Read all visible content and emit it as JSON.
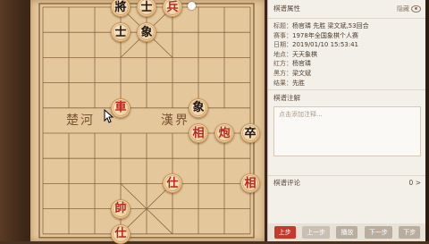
{
  "board": {
    "river_left": "楚河",
    "river_right": "漢界",
    "pieces": [
      {
        "char": "將",
        "side": "black",
        "col": 3,
        "row": 0
      },
      {
        "char": "士",
        "side": "black",
        "col": 4,
        "row": 0
      },
      {
        "char": "兵",
        "side": "red",
        "col": 5,
        "row": 0
      },
      {
        "char": "士",
        "side": "black",
        "col": 3,
        "row": 1
      },
      {
        "char": "象",
        "side": "black",
        "col": 4,
        "row": 1
      },
      {
        "char": "車",
        "side": "red",
        "col": 3,
        "row": 4
      },
      {
        "char": "象",
        "side": "black",
        "col": 6,
        "row": 4
      },
      {
        "char": "相",
        "side": "red",
        "col": 6,
        "row": 5
      },
      {
        "char": "炮",
        "side": "red",
        "col": 7,
        "row": 5
      },
      {
        "char": "卒",
        "side": "black",
        "col": 8,
        "row": 5
      },
      {
        "char": "仕",
        "side": "red",
        "col": 5,
        "row": 7
      },
      {
        "char": "相",
        "side": "red",
        "col": 8,
        "row": 7
      },
      {
        "char": "帥",
        "side": "red",
        "col": 3,
        "row": 8
      },
      {
        "char": "仕",
        "side": "red",
        "col": 3,
        "row": 9
      }
    ]
  },
  "panel": {
    "properties_title": "棋谱属性",
    "hide_label": "隐藏",
    "props": [
      {
        "key": "标题：",
        "value": "杨官璘 先胜 梁文斌,53回合"
      },
      {
        "key": "赛事：",
        "value": "1978年全国象棋个人赛"
      },
      {
        "key": "日期：",
        "value": "2019/01/10 15:53:41"
      },
      {
        "key": "地点：",
        "value": "天天象棋"
      },
      {
        "key": "红方：",
        "value": "杨官璘"
      },
      {
        "key": "黑方：",
        "value": "梁文斌"
      },
      {
        "key": "结果：",
        "value": "先胜"
      }
    ],
    "notes_title": "棋谱注解",
    "notes_placeholder": "点击添加注释...",
    "comment_title": "棋谱评论",
    "comment_arrow": "0 >",
    "controls": [
      "上步",
      "上一步",
      "播放",
      "下一步",
      "下步"
    ]
  },
  "colors": {
    "red_piece": "#b8261c",
    "black_piece": "#1e1510",
    "board": "#e4c79b",
    "active_control": "#c8392b"
  },
  "icons": {
    "hide": "eye-icon",
    "cursor": "pointer-cursor-icon"
  }
}
